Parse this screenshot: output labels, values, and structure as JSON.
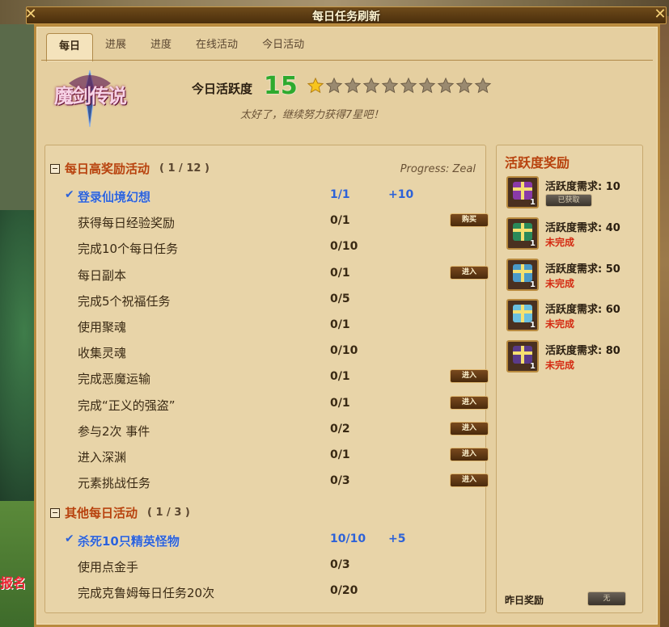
{
  "window": {
    "title": "每日任务刷新",
    "close_icon": "close-icon"
  },
  "background": {
    "sign_text": "报名"
  },
  "tabs": [
    {
      "label": "每日",
      "active": true
    },
    {
      "label": "进展",
      "active": false
    },
    {
      "label": "进度",
      "active": false
    },
    {
      "label": "在线活动",
      "active": false
    },
    {
      "label": "今日活动",
      "active": false
    }
  ],
  "header": {
    "logo_text": "魔剑传说",
    "activity_label": "今日活跃度",
    "activity_value": "15",
    "stars_filled": 1,
    "stars_total": 10,
    "encourage": "太好了，继续努力获得7星吧！"
  },
  "daily_high": {
    "title": "每日高奖励活动",
    "count": "( 1 / 12 )",
    "progress_label": "Progress: Zeal",
    "tasks": [
      {
        "name": "登录仙境幻想",
        "progress": "1/1",
        "reward": "+10",
        "done": true,
        "button": ""
      },
      {
        "name": "获得每日经验奖励",
        "progress": "0/1",
        "reward": "",
        "done": false,
        "button": "购买"
      },
      {
        "name": "完成10个每日任务",
        "progress": "0/10",
        "reward": "",
        "done": false,
        "button": ""
      },
      {
        "name": "每日副本",
        "progress": "0/1",
        "reward": "",
        "done": false,
        "button": "进入"
      },
      {
        "name": "完成5个祝福任务",
        "progress": "0/5",
        "reward": "",
        "done": false,
        "button": ""
      },
      {
        "name": "使用聚魂",
        "progress": "0/1",
        "reward": "",
        "done": false,
        "button": ""
      },
      {
        "name": "收集灵魂",
        "progress": "0/10",
        "reward": "",
        "done": false,
        "button": ""
      },
      {
        "name": "完成恶魔运输",
        "progress": "0/1",
        "reward": "",
        "done": false,
        "button": "进入"
      },
      {
        "name": "完成“正义的强盗”",
        "progress": "0/1",
        "reward": "",
        "done": false,
        "button": "进入"
      },
      {
        "name": "参与2次 事件",
        "progress": "0/2",
        "reward": "",
        "done": false,
        "button": "进入"
      },
      {
        "name": "进入深渊",
        "progress": "0/1",
        "reward": "",
        "done": false,
        "button": "进入"
      },
      {
        "name": "元素挑战任务",
        "progress": "0/3",
        "reward": "",
        "done": false,
        "button": "进入"
      }
    ]
  },
  "daily_other": {
    "title": "其他每日活动",
    "count": "( 1 / 3 )",
    "tasks": [
      {
        "name": "杀死10只精英怪物",
        "progress": "10/10",
        "reward": "+5",
        "done": true,
        "button": ""
      },
      {
        "name": "使用点金手",
        "progress": "0/3",
        "reward": "",
        "done": false,
        "button": ""
      },
      {
        "name": "完成克鲁姆每日任务20次",
        "progress": "0/20",
        "reward": "",
        "done": false,
        "button": ""
      }
    ]
  },
  "activity_rewards": {
    "title": "活跃度奖励",
    "items": [
      {
        "requirement": "活跃度需求: 10",
        "status": "已获取",
        "claimed": true,
        "qty": "1",
        "color": "#8a3aa8"
      },
      {
        "requirement": "活跃度需求: 40",
        "status": "未完成",
        "claimed": false,
        "qty": "1",
        "color": "#2a8a5a"
      },
      {
        "requirement": "活跃度需求: 50",
        "status": "未完成",
        "claimed": false,
        "qty": "1",
        "color": "#4a9ac8"
      },
      {
        "requirement": "活跃度需求: 60",
        "status": "未完成",
        "claimed": false,
        "qty": "1",
        "color": "#6ac0e0"
      },
      {
        "requirement": "活跃度需求: 80",
        "status": "未完成",
        "claimed": false,
        "qty": "1",
        "color": "#5a3a8a"
      }
    ],
    "yesterday_label": "昨日奖励",
    "yesterday_button": "无"
  }
}
